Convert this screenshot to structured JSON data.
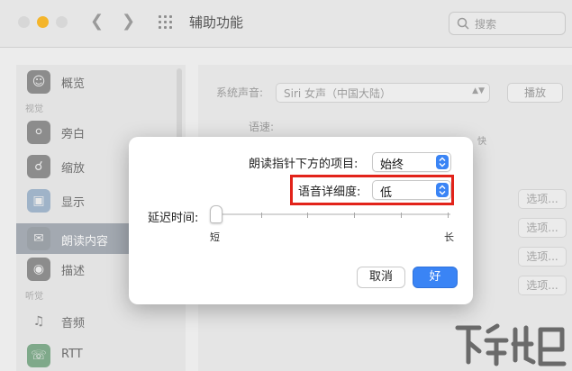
{
  "window": {
    "title": "辅助功能"
  },
  "search": {
    "placeholder": "搜索"
  },
  "sidebar": {
    "items": [
      {
        "label": "概览",
        "icon": "accessibility-icon"
      },
      {
        "label": "旁白",
        "icon": "voiceover-icon"
      },
      {
        "label": "缩放",
        "icon": "zoom-icon"
      },
      {
        "label": "显示",
        "icon": "display-icon"
      },
      {
        "label": "朗读内容",
        "icon": "speech-icon",
        "selected": true
      },
      {
        "label": "描述",
        "icon": "descriptions-icon"
      },
      {
        "label": "音频",
        "icon": "audio-icon"
      },
      {
        "label": "RTT",
        "icon": "rtt-icon"
      }
    ],
    "sections": {
      "vision": "视觉",
      "hearing": "听觉"
    }
  },
  "main": {
    "system_voice_label": "系统声音:",
    "system_voice_value": "Siri 女声（中国大陆）",
    "play_label": "播放",
    "rate_label": "语速:",
    "fast_label": "快",
    "option_label": "选项..."
  },
  "modal": {
    "speak_under_pointer_label": "朗读指针下方的项目:",
    "speak_under_pointer_value": "始终",
    "verbosity_label": "语音详细度:",
    "verbosity_value": "低",
    "delay_label": "延迟时间:",
    "slider_min": "短",
    "slider_max": "长",
    "slider_value": 0,
    "cancel_label": "取消",
    "ok_label": "好"
  },
  "colors": {
    "accent": "#3a84f5",
    "highlight": "#e2231a"
  }
}
